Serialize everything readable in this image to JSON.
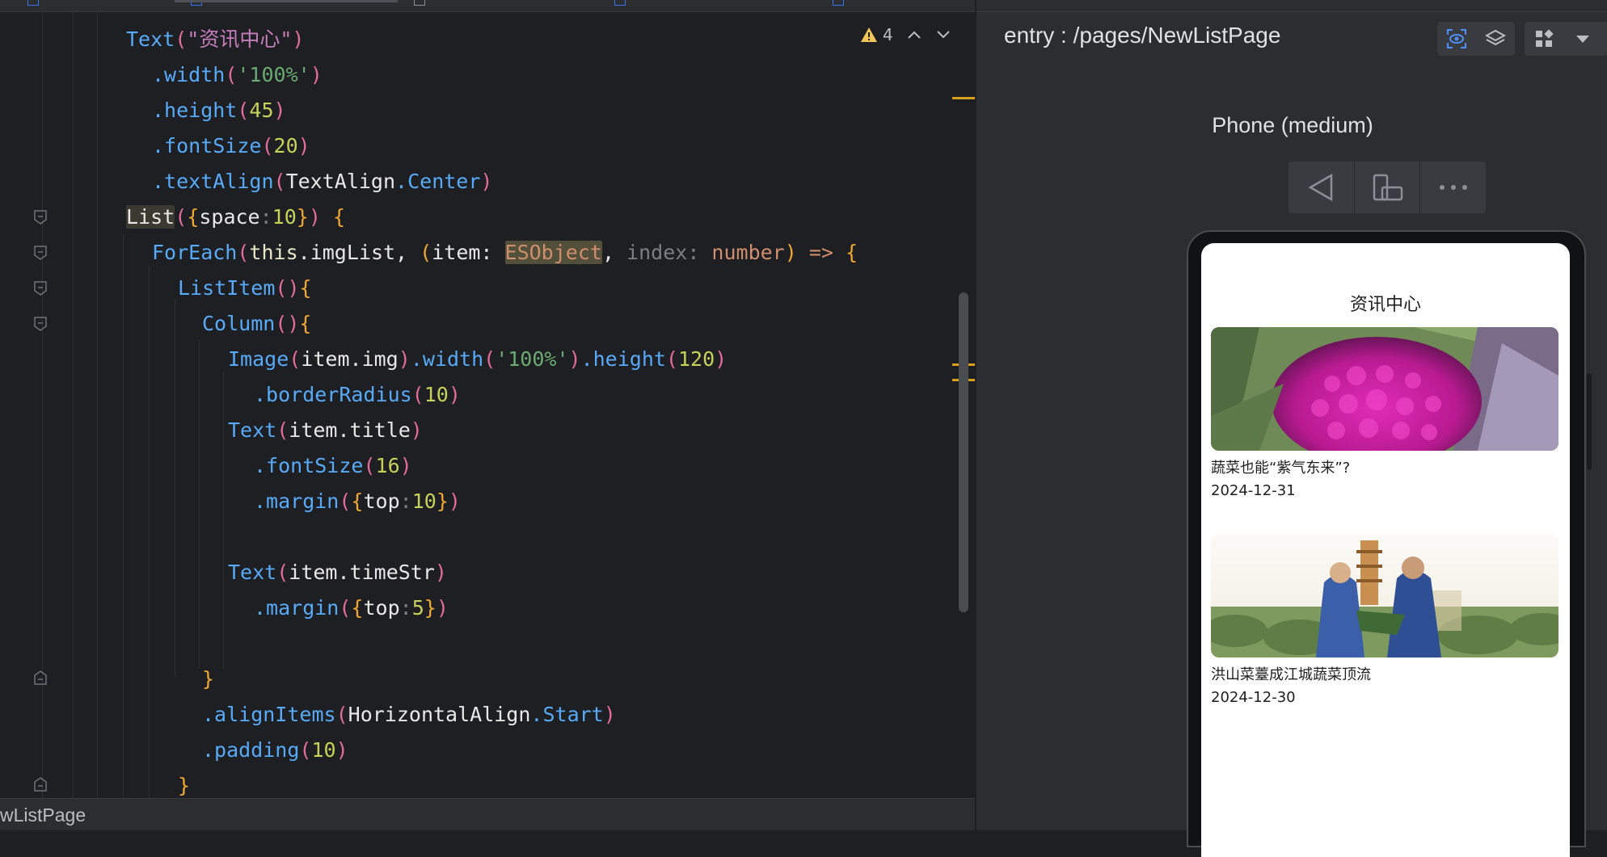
{
  "editor": {
    "warning_count": "4",
    "lines": [
      {
        "tokens": [
          [
            "fn",
            "Text"
          ],
          [
            "par",
            "("
          ],
          [
            "strp",
            "\"资讯中心\""
          ],
          [
            "par",
            ")"
          ]
        ]
      },
      {
        "tokens": [
          [
            "fn",
            ".width"
          ],
          [
            "par",
            "("
          ],
          [
            "str",
            "'100%'"
          ],
          [
            "par",
            ")"
          ]
        ]
      },
      {
        "tokens": [
          [
            "fn",
            ".height"
          ],
          [
            "par",
            "("
          ],
          [
            "num2",
            "45"
          ],
          [
            "par",
            ")"
          ]
        ]
      },
      {
        "tokens": [
          [
            "fn",
            ".fontSize"
          ],
          [
            "par",
            "("
          ],
          [
            "num2",
            "20"
          ],
          [
            "par",
            ")"
          ]
        ]
      },
      {
        "tokens": [
          [
            "fn",
            ".textAlign"
          ],
          [
            "par",
            "("
          ],
          [
            "white",
            "TextAlign"
          ],
          [
            "fn",
            ".Center"
          ],
          [
            "par",
            ")"
          ]
        ]
      },
      {
        "tokens": [
          [
            "list",
            "List"
          ],
          [
            "par",
            "("
          ],
          [
            "brc",
            "{"
          ],
          [
            "white",
            "space"
          ],
          [
            "gray",
            ":"
          ],
          [
            "num2",
            "10"
          ],
          [
            "brc",
            "}"
          ],
          [
            "par",
            ")"
          ],
          [
            "white",
            " "
          ],
          [
            "brc",
            "{"
          ]
        ]
      },
      {
        "tokens": [
          [
            "fn",
            "ForEach"
          ],
          [
            "par",
            "("
          ],
          [
            "kwb",
            "this"
          ],
          [
            "white",
            ".imgList, "
          ],
          [
            "brc",
            "("
          ],
          [
            "white",
            "item: "
          ],
          [
            "es",
            "ESObject"
          ],
          [
            "white",
            ", "
          ],
          [
            "gray",
            "index: "
          ],
          [
            "ty",
            "number"
          ],
          [
            "brc",
            ")"
          ],
          [
            "white",
            " "
          ],
          [
            "kw",
            "=>"
          ],
          [
            "white",
            " "
          ],
          [
            "brc",
            "{"
          ]
        ]
      },
      {
        "tokens": [
          [
            "fn",
            "ListItem"
          ],
          [
            "par",
            "()"
          ],
          [
            "brc",
            "{"
          ]
        ]
      },
      {
        "tokens": [
          [
            "fn",
            "Column"
          ],
          [
            "par",
            "()"
          ],
          [
            "brc",
            "{"
          ]
        ]
      },
      {
        "tokens": [
          [
            "fn",
            "Image"
          ],
          [
            "par",
            "("
          ],
          [
            "white",
            "item.img"
          ],
          [
            "par",
            ")"
          ],
          [
            "fn",
            ".width"
          ],
          [
            "par",
            "("
          ],
          [
            "str",
            "'100%'"
          ],
          [
            "par",
            ")"
          ],
          [
            "fn",
            ".height"
          ],
          [
            "par",
            "("
          ],
          [
            "num2",
            "120"
          ],
          [
            "par",
            ")"
          ]
        ]
      },
      {
        "tokens": [
          [
            "fn",
            ".borderRadius"
          ],
          [
            "par",
            "("
          ],
          [
            "num2",
            "10"
          ],
          [
            "par",
            ")"
          ]
        ]
      },
      {
        "tokens": [
          [
            "fn",
            "Text"
          ],
          [
            "par",
            "("
          ],
          [
            "white",
            "item.title"
          ],
          [
            "par",
            ")"
          ]
        ]
      },
      {
        "tokens": [
          [
            "fn",
            ".fontSize"
          ],
          [
            "par",
            "("
          ],
          [
            "num2",
            "16"
          ],
          [
            "par",
            ")"
          ]
        ]
      },
      {
        "tokens": [
          [
            "fn",
            ".margin"
          ],
          [
            "par",
            "("
          ],
          [
            "brc",
            "{"
          ],
          [
            "white",
            "top"
          ],
          [
            "gray",
            ":"
          ],
          [
            "num2",
            "10"
          ],
          [
            "brc",
            "}"
          ],
          [
            "par",
            ")"
          ]
        ]
      },
      {
        "tokens": []
      },
      {
        "tokens": [
          [
            "fn",
            "Text"
          ],
          [
            "par",
            "("
          ],
          [
            "white",
            "item.timeStr"
          ],
          [
            "par",
            ")"
          ]
        ]
      },
      {
        "tokens": [
          [
            "fn",
            ".margin"
          ],
          [
            "par",
            "("
          ],
          [
            "brc",
            "{"
          ],
          [
            "white",
            "top"
          ],
          [
            "gray",
            ":"
          ],
          [
            "num2",
            "5"
          ],
          [
            "brc",
            "}"
          ],
          [
            "par",
            ")"
          ]
        ]
      },
      {
        "tokens": []
      },
      {
        "tokens": [
          [
            "brc",
            "}"
          ]
        ]
      },
      {
        "tokens": [
          [
            "fn",
            ".alignItems"
          ],
          [
            "par",
            "("
          ],
          [
            "white",
            "HorizontalAlign"
          ],
          [
            "fn",
            ".Start"
          ],
          [
            "par",
            ")"
          ]
        ]
      },
      {
        "tokens": [
          [
            "fn",
            ".padding"
          ],
          [
            "par",
            "("
          ],
          [
            "num2",
            "10"
          ],
          [
            "par",
            ")"
          ]
        ]
      },
      {
        "tokens": [
          [
            "brc",
            "}"
          ]
        ]
      }
    ]
  },
  "status": {
    "text": "wListPage"
  },
  "preview": {
    "route": "entry : /pages/NewListPage",
    "device": "Phone (medium)",
    "page_title": "资讯中心",
    "news": [
      {
        "title": "蔬菜也能“紫气东来”?",
        "time": "2024-12-31"
      },
      {
        "title": "洪山菜薹成江城蔬菜顶流",
        "time": "2024-12-30"
      }
    ]
  }
}
